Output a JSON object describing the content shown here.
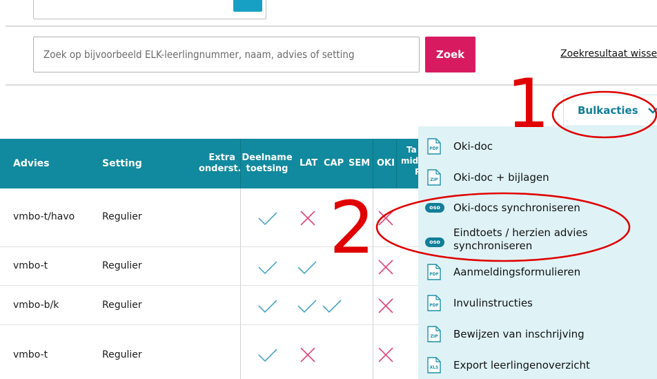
{
  "search": {
    "placeholder": "Zoek op bijvoorbeeld ELK-leerlingnummer, naam, advies of setting",
    "button_label": "Zoek",
    "clear_label": "Zoekresultaat wissen"
  },
  "bulk": {
    "button_label": "Bulkacties"
  },
  "table": {
    "headers": {
      "advies": "Advies",
      "setting": "Setting",
      "extra_1": "Extra",
      "extra_2": "onderst.",
      "deelname_1": "Deelname",
      "deelname_2": "toetsing",
      "lat": "LAT",
      "cap": "CAP",
      "sem": "SEM",
      "oki": "OKI",
      "partial_1": "Ta",
      "partial_2": "mid",
      "partial_3": "P"
    },
    "rows": [
      {
        "advies": "vmbo-t/havo",
        "setting": "Regulier"
      },
      {
        "advies": "vmbo-t",
        "setting": "Regulier"
      },
      {
        "advies": "vmbo-b/k",
        "setting": "Regulier"
      },
      {
        "advies": "vmbo-t",
        "setting": "Regulier"
      }
    ]
  },
  "menu": {
    "items": [
      {
        "label": "Oki-doc",
        "icon": "PDF"
      },
      {
        "label": "Oki-doc + bijlagen",
        "icon": "ZIP"
      },
      {
        "label": "Oki-docs synchroniseren",
        "icon": "oso"
      },
      {
        "label_1": "Eindtoets / herzien advies",
        "label_2": "synchroniseren",
        "icon": "oso"
      },
      {
        "label": "Aanmeldingsformulieren",
        "icon": "PDF"
      },
      {
        "label": "Invulinstructies",
        "icon": "PDF"
      },
      {
        "label": "Bewijzen van inschrijving",
        "icon": "ZIP"
      },
      {
        "label": "Export leerlingenoverzicht",
        "icon": "XLS"
      }
    ]
  },
  "annotations": {
    "one": "1",
    "two": "2"
  },
  "colors": {
    "primary_teal": "#11899e",
    "accent_pink": "#d81b60",
    "menu_bg": "#dff3f6",
    "check": "#4aa6c4",
    "cross": "#e0457b",
    "annotation_red": "#e00000"
  }
}
